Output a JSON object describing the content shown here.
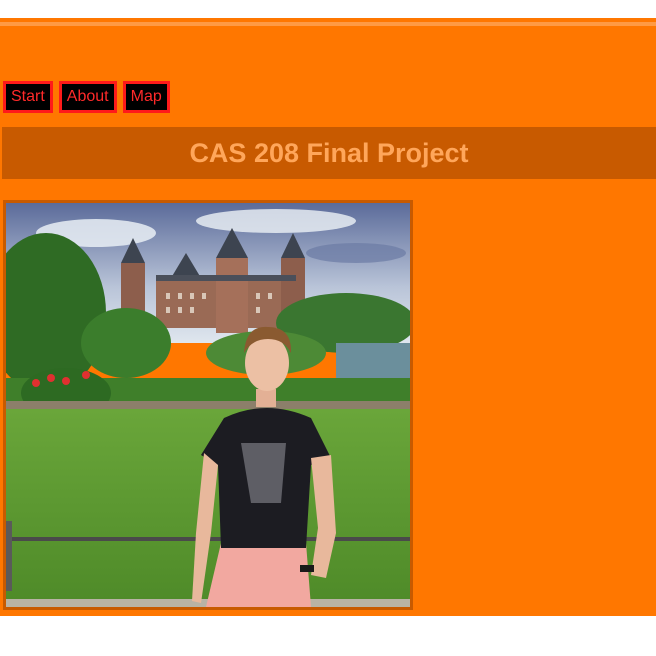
{
  "nav": {
    "items": [
      {
        "label": "Start"
      },
      {
        "label": "About"
      },
      {
        "label": "Map"
      }
    ]
  },
  "header": {
    "title": "CAS 208 Final Project"
  },
  "colors": {
    "page_bg": "#ff7700",
    "banner_bg": "#c85a00",
    "title_color": "#ffa65a",
    "nav_bg": "#000000",
    "nav_border": "#ff1a1a",
    "nav_text": "#ff2a2a"
  },
  "photo": {
    "subject": "man standing in front of castle garden"
  }
}
